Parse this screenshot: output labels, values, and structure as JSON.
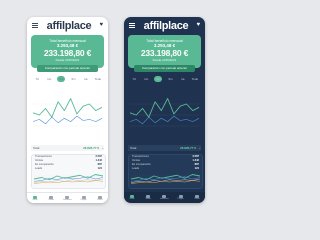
{
  "app": {
    "logo": "affilplace",
    "summary": {
      "title": "Total beneficio mensual",
      "monthly_value": "3.293,48 €",
      "total_value": "233.198,80 €",
      "subtitle": "Desde 2015/2021",
      "comparison": "Comparación con periodo anterior"
    },
    "periods": [
      "7d",
      "1m",
      "3m",
      "6m",
      "1a",
      "Todo"
    ],
    "active_period_index": 2,
    "total": {
      "label": "Total",
      "value": "26.895,77 €",
      "chevron": "⌄"
    },
    "breakdown": [
      {
        "label": "Transacciones",
        "value": "2.587"
      },
      {
        "label": "Ventas",
        "value": "1.342"
      },
      {
        "label": "En comparación",
        "value": "887"
      },
      {
        "label": "Leads",
        "value": "124"
      }
    ],
    "nav": [
      "Inicio",
      "Webs",
      "Informes",
      "Pagos",
      "Perfil"
    ],
    "active_nav_index": 0
  },
  "colors": {
    "accent": "#58b994",
    "light_background": "#ffffff",
    "dark_background": "#1f3350",
    "series": [
      "#58b994",
      "#4a90d9",
      "#b9c4d3",
      "#e8a23d",
      "#a97be0"
    ]
  },
  "chart_data": [
    {
      "type": "line",
      "series": [
        {
          "values": [
            22,
            20,
            26,
            18,
            32,
            24,
            35,
            21,
            28,
            30,
            24,
            27
          ]
        },
        {
          "values": [
            14,
            16,
            12,
            18,
            13,
            17,
            14,
            19,
            15,
            16,
            14,
            17
          ]
        }
      ],
      "ylim": [
        0,
        40
      ]
    },
    {
      "type": "line",
      "series": [
        {
          "values": [
            8,
            10,
            7,
            12,
            9,
            11,
            13,
            9,
            14,
            12
          ]
        },
        {
          "values": [
            5,
            6,
            9,
            7,
            10,
            8,
            9,
            11,
            8,
            10
          ]
        },
        {
          "values": [
            3,
            5,
            4,
            6,
            5,
            7,
            6,
            7,
            6,
            8
          ]
        },
        {
          "values": [
            2,
            3,
            4,
            3,
            5,
            4,
            5,
            4,
            6,
            5
          ]
        }
      ],
      "ylim": [
        0,
        16
      ]
    }
  ]
}
